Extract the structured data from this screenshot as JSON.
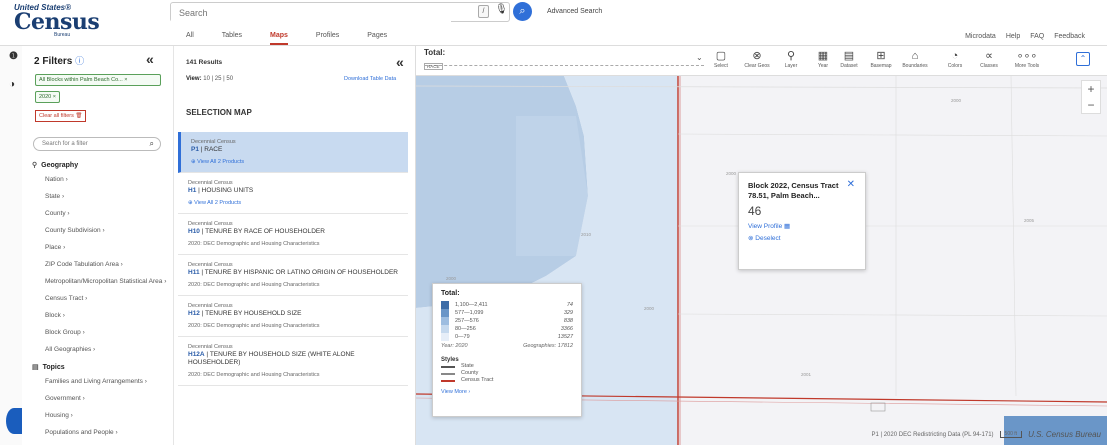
{
  "header": {
    "logo_top": "United States®",
    "logo_main": "Census",
    "logo_sub": "Bureau",
    "search_placeholder": "Search",
    "kbd": "/",
    "advanced": "Advanced Search",
    "tabs": [
      "All",
      "Tables",
      "Maps",
      "Profiles",
      "Pages"
    ],
    "active_tab": "Maps",
    "links": [
      "Microdata",
      "Help",
      "FAQ",
      "Feedback"
    ]
  },
  "filters": {
    "title": "2 Filters",
    "chips": [
      "All Blocks within Palm Beach Co... ×",
      "2020 ×"
    ],
    "clear_all": "Clear all filters",
    "search_placeholder": "Search for a filter",
    "geography_header": "Geography",
    "geography_items": [
      "Nation ›",
      "State ›",
      "County ›",
      "County Subdivision ›",
      "Place ›",
      "ZIP Code Tabulation Area ›",
      "Metropolitan/Micropolitan Statistical Area ›",
      "Census Tract ›",
      "Block ›",
      "Block Group ›",
      "All Geographies ›"
    ],
    "topics_header": "Topics",
    "topics_items": [
      "Families and Living Arrangements ›",
      "Government ›",
      "Housing ›",
      "Populations and People ›"
    ]
  },
  "results": {
    "count": "141 Results",
    "view_label": "View:",
    "view_options": "10 | 25 | 50",
    "view_selected": "10",
    "download": "Download Table Data",
    "selection_map": "SELECTION MAP",
    "items": [
      {
        "source": "Decennial Census",
        "code": "P1",
        "name": "RACE",
        "sub": "View All 2 Products",
        "link": true,
        "selected": true
      },
      {
        "source": "Decennial Census",
        "code": "H1",
        "name": "HOUSING UNITS",
        "sub": "View All 2 Products",
        "link": true,
        "selected": false
      },
      {
        "source": "Decennial Census",
        "code": "H10",
        "name": "TENURE BY RACE OF HOUSEHOLDER",
        "sub": "2020: DEC Demographic and Housing Characteristics",
        "link": false,
        "selected": false
      },
      {
        "source": "Decennial Census",
        "code": "H11",
        "name": "TENURE BY HISPANIC OR LATINO ORIGIN OF HOUSEHOLDER",
        "sub": "2020: DEC Demographic and Housing Characteristics",
        "link": false,
        "selected": false
      },
      {
        "source": "Decennial Census",
        "code": "H12",
        "name": "TENURE BY HOUSEHOLD SIZE",
        "sub": "2020: DEC Demographic and Housing Characteristics",
        "link": false,
        "selected": false
      },
      {
        "source": "Decennial Census",
        "code": "H12A",
        "name": "TENURE BY HOUSEHOLD SIZE (WHITE ALONE HOUSEHOLDER)",
        "sub": "2020: DEC Demographic and Housing Characteristics",
        "link": false,
        "selected": false
      }
    ]
  },
  "map": {
    "title": "Total:",
    "title_chip": "RACE",
    "tools": [
      {
        "icon": "▢",
        "label": "Select",
        "name": "select-tool"
      },
      {
        "icon": "⊗",
        "label": "Clear Geos",
        "name": "clear-geos-tool"
      },
      {
        "icon": "⚲",
        "label": "Layer",
        "name": "layer-tool"
      },
      {
        "icon": "▦",
        "label": "Year",
        "name": "year-tool"
      },
      {
        "icon": "▤",
        "label": "Dataset",
        "name": "dataset-tool"
      },
      {
        "icon": "⊞",
        "label": "Basemap",
        "name": "basemap-tool"
      },
      {
        "icon": "⌂",
        "label": "Boundaries",
        "name": "boundaries-tool"
      },
      {
        "icon": "◔",
        "label": "Colors",
        "name": "colors-tool"
      },
      {
        "icon": "∝",
        "label": "Classes",
        "name": "classes-tool"
      },
      {
        "icon": "∘∘∘",
        "label": "More Tools",
        "name": "more-tools-tool"
      }
    ],
    "popup": {
      "title": "Block 2022, Census Tract 78.51, Palm Beach...",
      "value": "46",
      "view_profile": "View Profile",
      "deselect": "Deselect"
    },
    "legend": {
      "title": "Total:",
      "classes": [
        {
          "range": "1,100—2,411",
          "count": "74",
          "color": "#3d6da8"
        },
        {
          "range": "577—1,099",
          "count": "329",
          "color": "#6a96c8"
        },
        {
          "range": "257—576",
          "count": "838",
          "color": "#9dbde0"
        },
        {
          "range": "80—256",
          "count": "3366",
          "color": "#c5d9ee"
        },
        {
          "range": "0—79",
          "count": "13527",
          "color": "#e6eef8"
        }
      ],
      "year": "Year: 2020",
      "geographies": "Geographies: 17812",
      "styles_title": "Styles",
      "styles": [
        {
          "label": "State",
          "color": "#555555"
        },
        {
          "label": "County",
          "color": "#888888"
        },
        {
          "label": "Census Tract",
          "color": "#c0392b"
        }
      ],
      "view_more": "View More ›"
    },
    "labels": {
      "l2000a": "2000",
      "l2000b": "2000",
      "l2001": "2001",
      "l2005": "2005",
      "l2010": "2010",
      "l2000c": "2000",
      "l2000d": "2000"
    },
    "attribution": "P1 | 2020 DEC Redistricting Data (PL 94-171)",
    "scale": "500 ft",
    "ucb": "U.S. Census Bureau"
  }
}
